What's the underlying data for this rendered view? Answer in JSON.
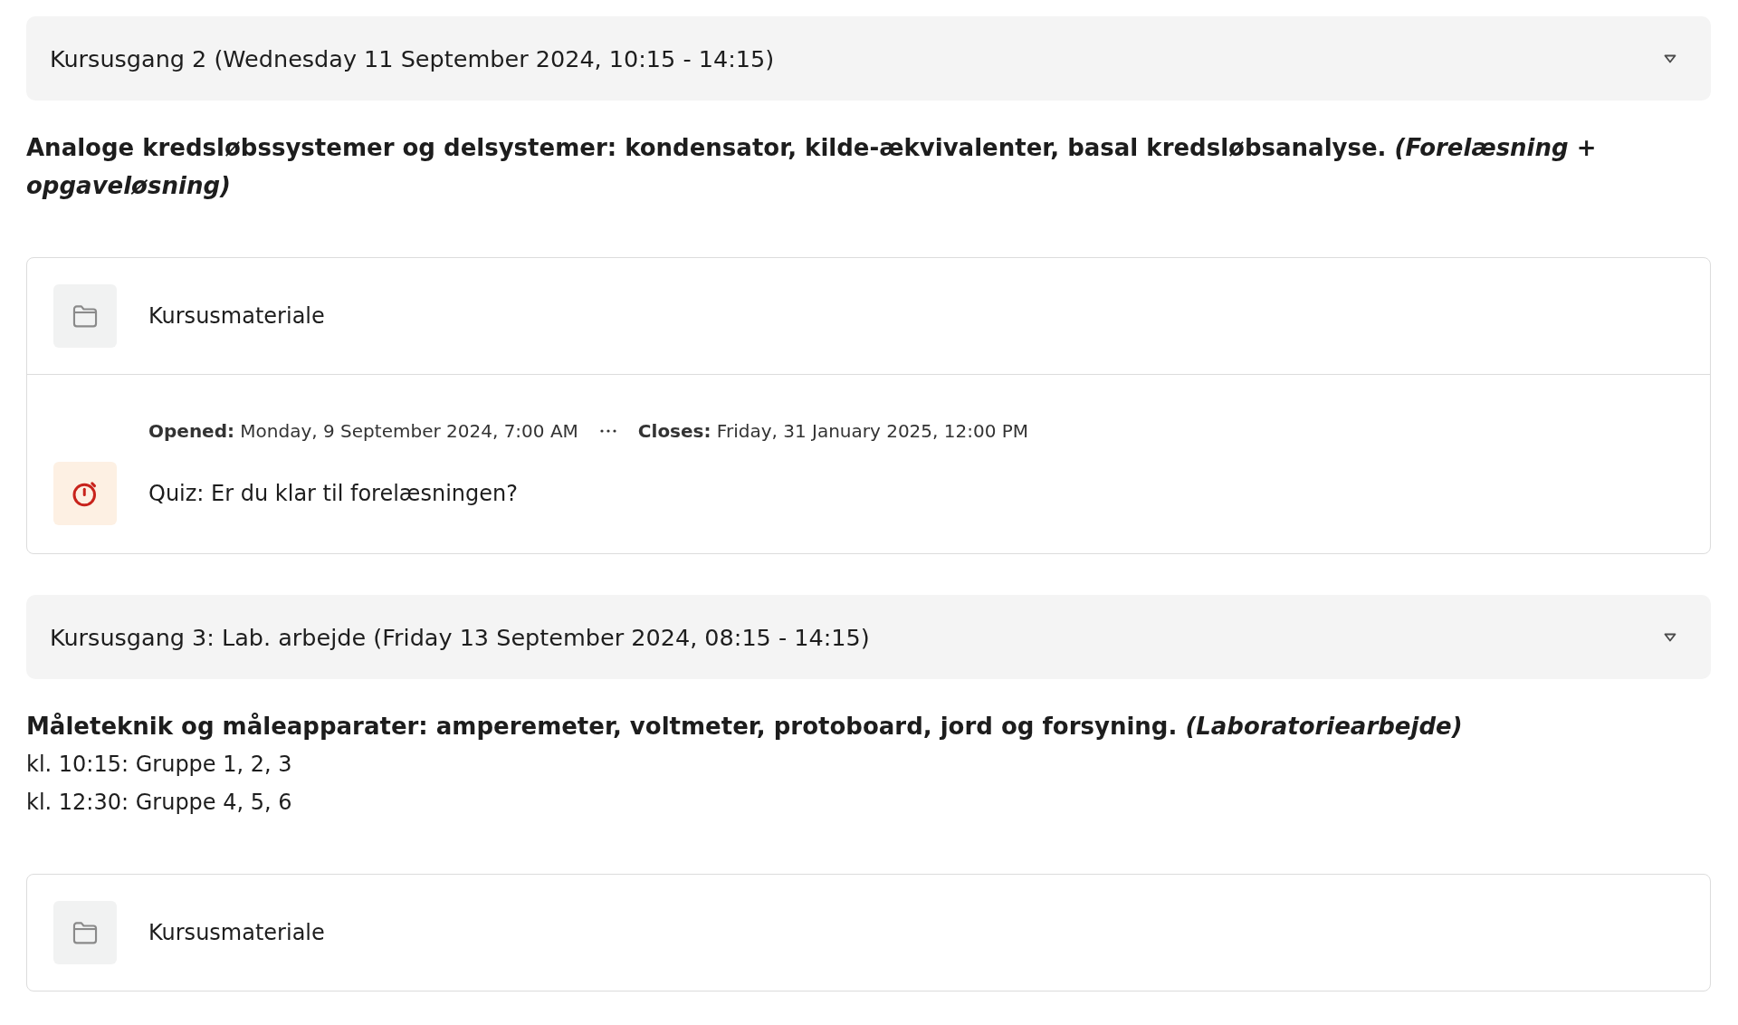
{
  "sections": [
    {
      "title": "Kursusgang 2 (Wednesday 11 September 2024, 10:15 - 14:15)",
      "expanded": true,
      "summary": [
        {
          "text": "Analoge kredsløbssystemer og delsystemer: kondensator, kilde-ækvivalenter, basal kredsløbsanalyse. *(Forelæsning + opgaveløsning)*",
          "bold": true
        }
      ],
      "activities": [
        {
          "kind": "folder",
          "title": "Kursusmateriale"
        },
        {
          "kind": "quiz",
          "title": "Quiz: Er du klar til forelæsningen?",
          "dates": [
            "**Opened:** Monday, 9 September 2024, 7:00 AM",
            "**Closes:** Friday, 31 January 2025, 12:00 PM"
          ]
        }
      ]
    },
    {
      "title": "Kursusgang 3: Lab. arbejde (Friday 13 September 2024, 08:15 - 14:15)",
      "expanded": true,
      "summary": [
        {
          "text": "Måleteknik og måleapparater: amperemeter, voltmeter, protoboard, jord og forsyning. *(Laboratoriearbejde)*",
          "bold": true
        },
        {
          "text": "kl. 10:15: Gruppe 1, 2, 3",
          "bold": false
        },
        {
          "text": "kl. 12:30: Gruppe 4, 5, 6",
          "bold": false
        }
      ],
      "activities": [
        {
          "kind": "folder",
          "title": "Kursusmateriale"
        }
      ]
    }
  ]
}
